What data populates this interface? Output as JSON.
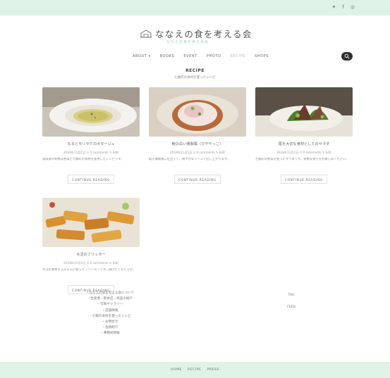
{
  "topbar": {
    "social": [
      {
        "icon": "twitter-icon",
        "glyph": "✦"
      },
      {
        "icon": "facebook-icon",
        "glyph": "f"
      },
      {
        "icon": "instagram-icon",
        "glyph": "◎"
      }
    ]
  },
  "header": {
    "site_title": "ななえの食を考える会",
    "site_subtitle": "ななえの食を考える会"
  },
  "nav": {
    "items": [
      {
        "label": "ABOUT ▾",
        "active": false
      },
      {
        "label": "BOOKS",
        "active": false
      },
      {
        "label": "EVENT",
        "active": false
      },
      {
        "label": "PHOTO",
        "active": false
      },
      {
        "label": "RECIPE",
        "active": true
      },
      {
        "label": "SHOPS",
        "active": false
      }
    ]
  },
  "recipes": {
    "title": "RECIPE",
    "subtitle": "七飯町の食材を使ったレシピ",
    "button_label": "CONTINUE READING",
    "cards": [
      {
        "title": "なるとモリタケのポタージュ",
        "meta": "2018年11月1日   ⊙ 0 comments   ✎ Edit",
        "excerpt": "道南産の新鮮な野菜と七飯町の食材を使用したレシピです。"
      },
      {
        "title": "鮭の白い燻製風（ひややっこ）",
        "meta": "2018年11月1日   ⊙ 0 comments   ✎ Edit",
        "excerpt": "鮭を燻製風に仕立てて、爽やかなソースで召し上がります。"
      },
      {
        "title": "尾を大切な食材としてのサラダ",
        "meta": "2018年11月1日   ⊙ 0 comments   ✎ Edit",
        "excerpt": "七飯町の野菜を使ったサラダです。新鮮な香りをお楽しみください。"
      },
      {
        "title": "大沼のフリッター",
        "meta": "2018年11月1日   ⊙ 0 comments   ✎ Edit",
        "excerpt": "大沼の食材をふんだんに使ったフリッターです。揚げたてをどうぞ。"
      }
    ]
  },
  "footer_links": [
    "・ななえの食を考える会について",
    "・生産者・飲食店・商品の紹介",
    "・写真ギャラリー",
    "・店舗情報",
    "・七飯の食材を使ったレシピ",
    "・お問合せ",
    "・会員紹介",
    "・事務局情報"
  ],
  "tags": [
    "TAG",
    "FEED"
  ],
  "footer": {
    "items": [
      "HOME",
      "RECIPE",
      "PRESS"
    ]
  },
  "colors": {
    "bar_bg": "#def3e6",
    "accent": "#9bd0b1",
    "search_bg": "#2f2f2f"
  }
}
